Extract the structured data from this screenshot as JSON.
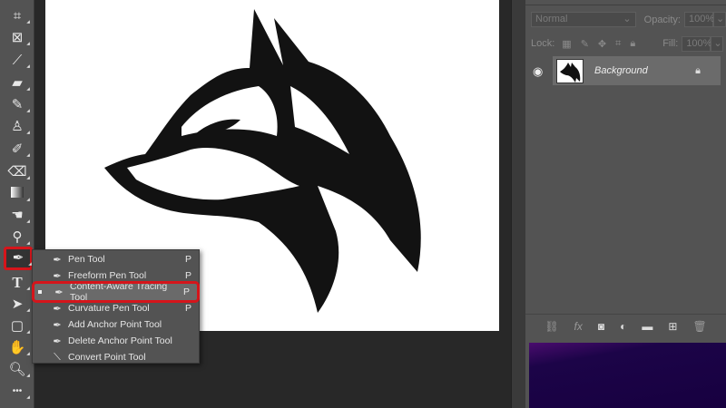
{
  "layers_panel": {
    "blend_mode": "Normal",
    "opacity_label": "Opacity:",
    "opacity_value": "100%",
    "lock_label": "Lock:",
    "fill_label": "Fill:",
    "fill_value": "100%",
    "layer_name": "Background"
  },
  "bottom_icons": [
    "link-icon",
    "fx-icon",
    "mask-icon",
    "adjustment-icon",
    "folder-icon",
    "new-layer-icon",
    "trash-icon"
  ],
  "fx_label": "fx",
  "flyout": [
    {
      "label": "Pen Tool",
      "shortcut": "P"
    },
    {
      "label": "Freeform Pen Tool",
      "shortcut": "P"
    },
    {
      "label": "Content-Aware Tracing Tool",
      "shortcut": "P",
      "selected": true
    },
    {
      "label": "Curvature Pen Tool",
      "shortcut": "P"
    },
    {
      "label": "Add Anchor Point Tool",
      "shortcut": ""
    },
    {
      "label": "Delete Anchor Point Tool",
      "shortcut": ""
    },
    {
      "label": "Convert Point Tool",
      "shortcut": ""
    }
  ],
  "toolbar": {
    "type_tool": "T",
    "more": "•••"
  },
  "colors": {
    "highlight": "#d5151b",
    "panel": "#535353"
  }
}
